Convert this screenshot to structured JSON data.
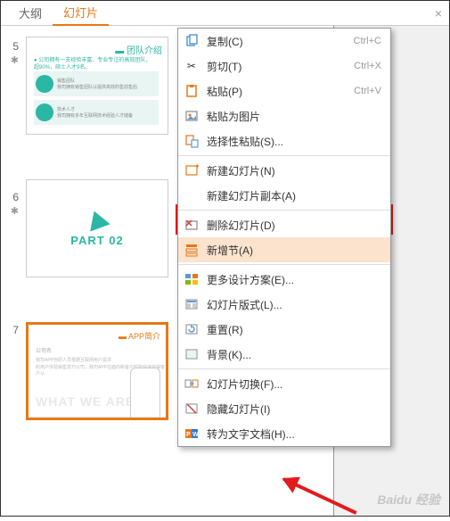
{
  "tabs": {
    "outline": "大纲",
    "slides": "幻灯片"
  },
  "slideNumbers": {
    "s5": "5",
    "s6": "6",
    "s7": "7"
  },
  "thumb5": {
    "title": "▬ 团队介绍",
    "line1": "● 公司拥有一支经验丰富、专业专注的高效团队，",
    "line2": "超90%，硕士人才9名。",
    "box1_title": "销售团队",
    "box1_sub": "我司拥有销售团队以提供高效的售前售后",
    "box2_title": "技术人才",
    "box2_sub": "我司拥有多年互联网技术经验人才储备"
  },
  "thumb6": {
    "part": "PART 02"
  },
  "thumb7": {
    "title": "▬ APP简介",
    "sub": "公司名",
    "line1": "我司APP自研人员根据互联网用户需求",
    "line2": "的用户体验销售技巧公司，我司APP在面向新客户时能快速获得客户认",
    "what": "WHAT WE ARE"
  },
  "menu": {
    "copy": "复制(C)",
    "copy_sc": "Ctrl+C",
    "cut": "剪切(T)",
    "cut_sc": "Ctrl+X",
    "paste": "粘贴(P)",
    "paste_sc": "Ctrl+V",
    "paste_pic": "粘贴为图片",
    "paste_special": "选择性粘贴(S)...",
    "new_slide": "新建幻灯片(N)",
    "duplicate": "新建幻灯片副本(A)",
    "delete": "删除幻灯片(D)",
    "new_section": "新增节(A)",
    "more_design": "更多设计方案(E)...",
    "layout": "幻灯片版式(L)...",
    "reset": "重置(R)",
    "background": "背景(K)...",
    "transition": "幻灯片切换(F)...",
    "hide": "隐藏幻灯片(I)",
    "to_word": "转为文字文档(H)..."
  },
  "icons": {
    "copy_color": "#5b9bd5",
    "cut_color": "#888",
    "paste_color": "#e67817",
    "delete_color": "#d04040",
    "section_color": "#e67817",
    "design_color": "#5b9bd5",
    "word_color": "#2b7cd3"
  },
  "watermark": "Baidu 经验"
}
